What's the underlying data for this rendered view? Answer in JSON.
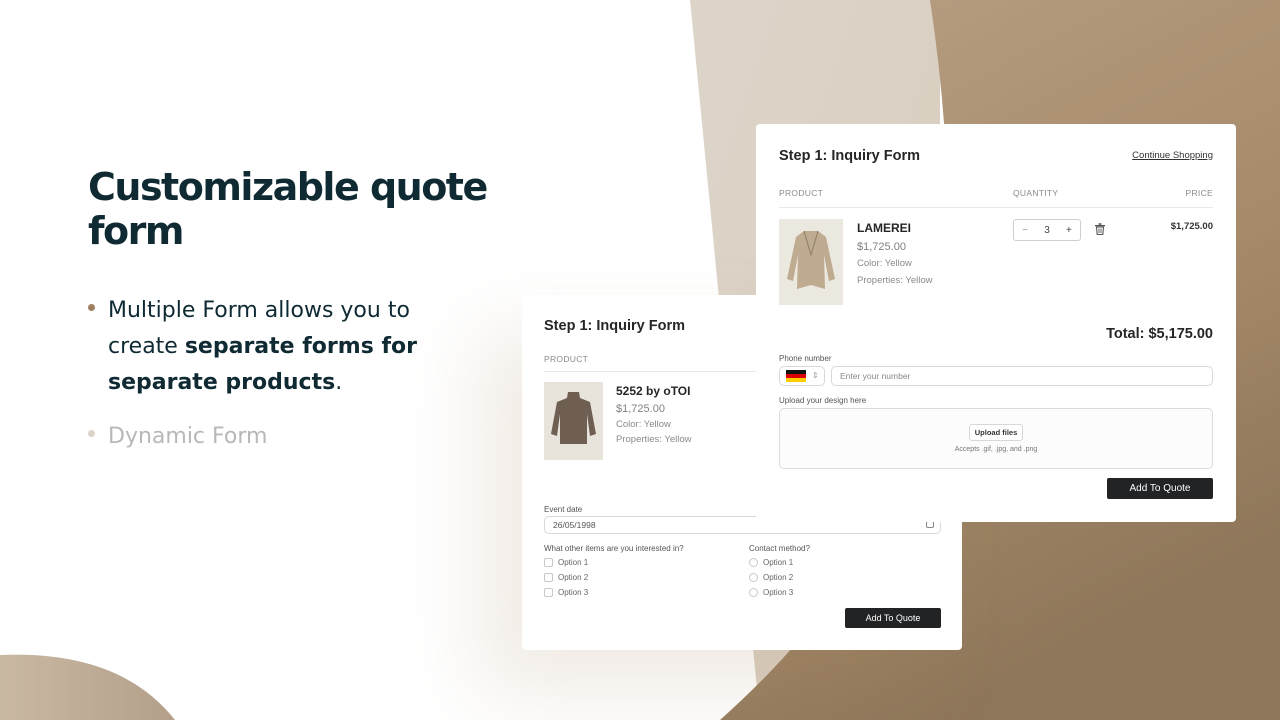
{
  "colors": {
    "heading": "#0f2a33",
    "accent_dot": "#a08060",
    "muted_dot": "#ddd3c8",
    "bg_light": "#ddd5ca",
    "bg_tan": "#b49c7e",
    "bg_dark": "#8e765a",
    "button_dark": "#222325"
  },
  "hero": {
    "title": "Customizable quote form",
    "bullets": [
      {
        "text_before": "Multiple Form allows you to create ",
        "bold": "separate forms for separate products",
        "text_after": ".",
        "active": true
      },
      {
        "text": "Dynamic Form",
        "active": false
      }
    ]
  },
  "form_back": {
    "title": "Step 1: Inquiry Form",
    "col_product": "PRODUCT",
    "product": {
      "name": "5252 by oTOI",
      "price": "$1,725.00",
      "color": "Color: Yellow",
      "properties": "Properties: Yellow",
      "image": "brown-turtleneck-sweater"
    },
    "event_date_label": "Event date",
    "event_date_value": "26/05/1998",
    "calendar_icon": "calendar-icon",
    "interests_label": "What other items are you interested in?",
    "interests_options": [
      "Option 1",
      "Option 2",
      "Option 3"
    ],
    "contact_label": "Contact method?",
    "contact_options": [
      "Option 1",
      "Option 2",
      "Option 3"
    ],
    "submit_label": "Add To Quote"
  },
  "form_front": {
    "title": "Step 1: Inquiry Form",
    "continue_link": "Continue Shopping",
    "col_product": "PRODUCT",
    "col_quantity": "QUANTITY",
    "col_price": "PRICE",
    "product": {
      "name": "LAMEREI",
      "price": "$1,725.00",
      "color": "Color: Yellow",
      "properties": "Properties: Yellow",
      "image": "beige-cardigan",
      "quantity": "3",
      "line_price": "$1,725.00"
    },
    "minus": "−",
    "plus": "+",
    "total": "Total: $5,175.00",
    "phone_label": "Phone number",
    "phone_country": "DE",
    "phone_placeholder": "Enter your number",
    "upload_label": "Upload your design here",
    "upload_button": "Upload files",
    "upload_hint": "Accepts .gif, .jpg, and .png",
    "submit_label": "Add To Quote"
  }
}
